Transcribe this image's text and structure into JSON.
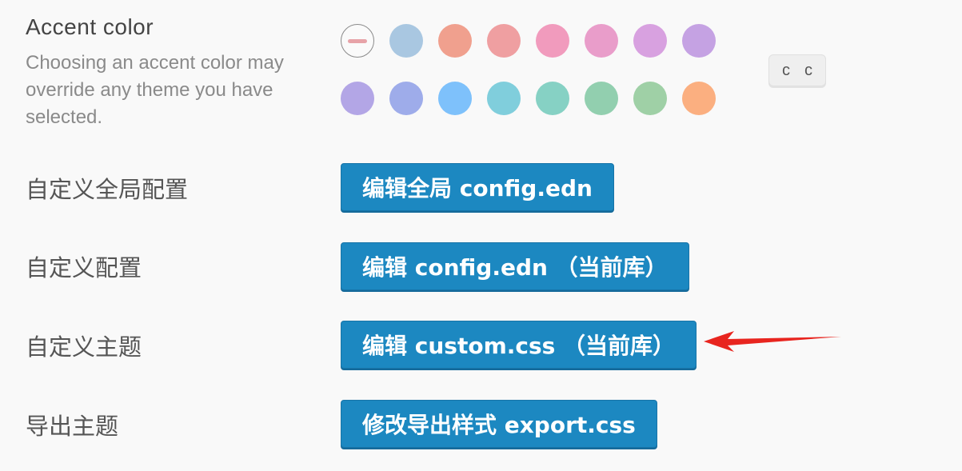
{
  "accent": {
    "title": "Accent color",
    "description": "Choosing an accent color may override any theme you have selected.",
    "shortcut_keys": [
      "c",
      "c"
    ],
    "swatches_row1": [
      {
        "name": "none",
        "color": "none"
      },
      {
        "name": "blue-gray",
        "color": "#a9c7e1"
      },
      {
        "name": "tomato",
        "color": "#f0a08e"
      },
      {
        "name": "red",
        "color": "#ef9fa1"
      },
      {
        "name": "crimson",
        "color": "#f19bbd"
      },
      {
        "name": "pink",
        "color": "#e99dca"
      },
      {
        "name": "plum",
        "color": "#d8a1e0"
      },
      {
        "name": "purple",
        "color": "#c5a2e3"
      }
    ],
    "swatches_row2": [
      {
        "name": "violet",
        "color": "#b3a6e6"
      },
      {
        "name": "indigo",
        "color": "#9eacea"
      },
      {
        "name": "blue",
        "color": "#7ec1fb"
      },
      {
        "name": "cyan",
        "color": "#80cedc"
      },
      {
        "name": "teal",
        "color": "#86d1c4"
      },
      {
        "name": "green",
        "color": "#92cfaf"
      },
      {
        "name": "grass",
        "color": "#9fd0a6"
      },
      {
        "name": "orange",
        "color": "#fbaf80"
      }
    ]
  },
  "rows": [
    {
      "label": "自定义全局配置",
      "button": "编辑全局 config.edn"
    },
    {
      "label": "自定义配置",
      "button": "编辑 config.edn （当前库）"
    },
    {
      "label": "自定义主题",
      "button": "编辑 custom.css （当前库）"
    },
    {
      "label": "导出主题",
      "button": "修改导出样式 export.css"
    }
  ],
  "colors": {
    "button_bg": "#1c88c1",
    "arrow": "#e8251f"
  }
}
